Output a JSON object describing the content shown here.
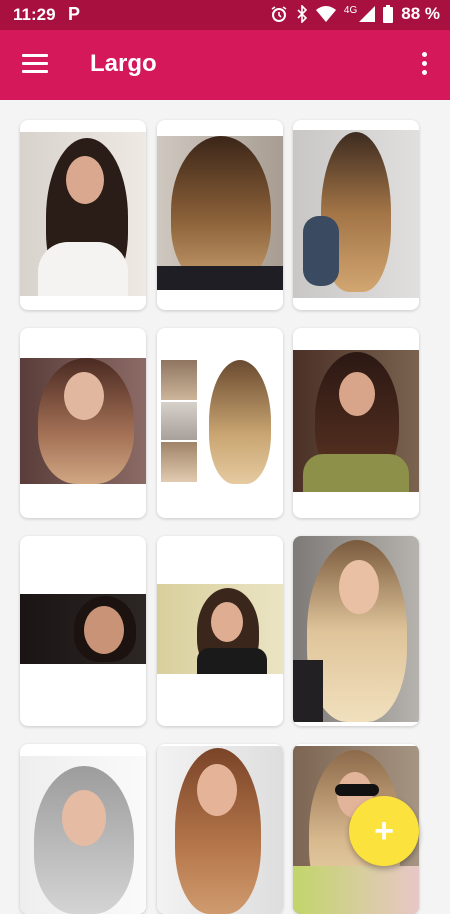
{
  "status_bar": {
    "time": "11:29",
    "app_badge": "P",
    "network": "4G",
    "battery": "88 %",
    "icons": [
      "alarm-icon",
      "bluetooth-icon",
      "wifi-icon",
      "signal-icon",
      "battery-icon"
    ]
  },
  "app_bar": {
    "title": "Largo",
    "menu_icon": "hamburger-menu-icon",
    "overflow_icon": "more-vertical-icon"
  },
  "gallery": {
    "items": [
      {
        "name": "hairstyle-1"
      },
      {
        "name": "hairstyle-2"
      },
      {
        "name": "hairstyle-3"
      },
      {
        "name": "hairstyle-4"
      },
      {
        "name": "hairstyle-5"
      },
      {
        "name": "hairstyle-6"
      },
      {
        "name": "hairstyle-7"
      },
      {
        "name": "hairstyle-8"
      },
      {
        "name": "hairstyle-9"
      },
      {
        "name": "hairstyle-10"
      },
      {
        "name": "hairstyle-11"
      },
      {
        "name": "hairstyle-12"
      }
    ]
  },
  "fab": {
    "icon": "plus-icon",
    "label": "+"
  },
  "colors": {
    "status_bar": "#a8113f",
    "app_bar": "#d4185a",
    "fab": "#fbe23c",
    "background": "#f4f4f4"
  }
}
